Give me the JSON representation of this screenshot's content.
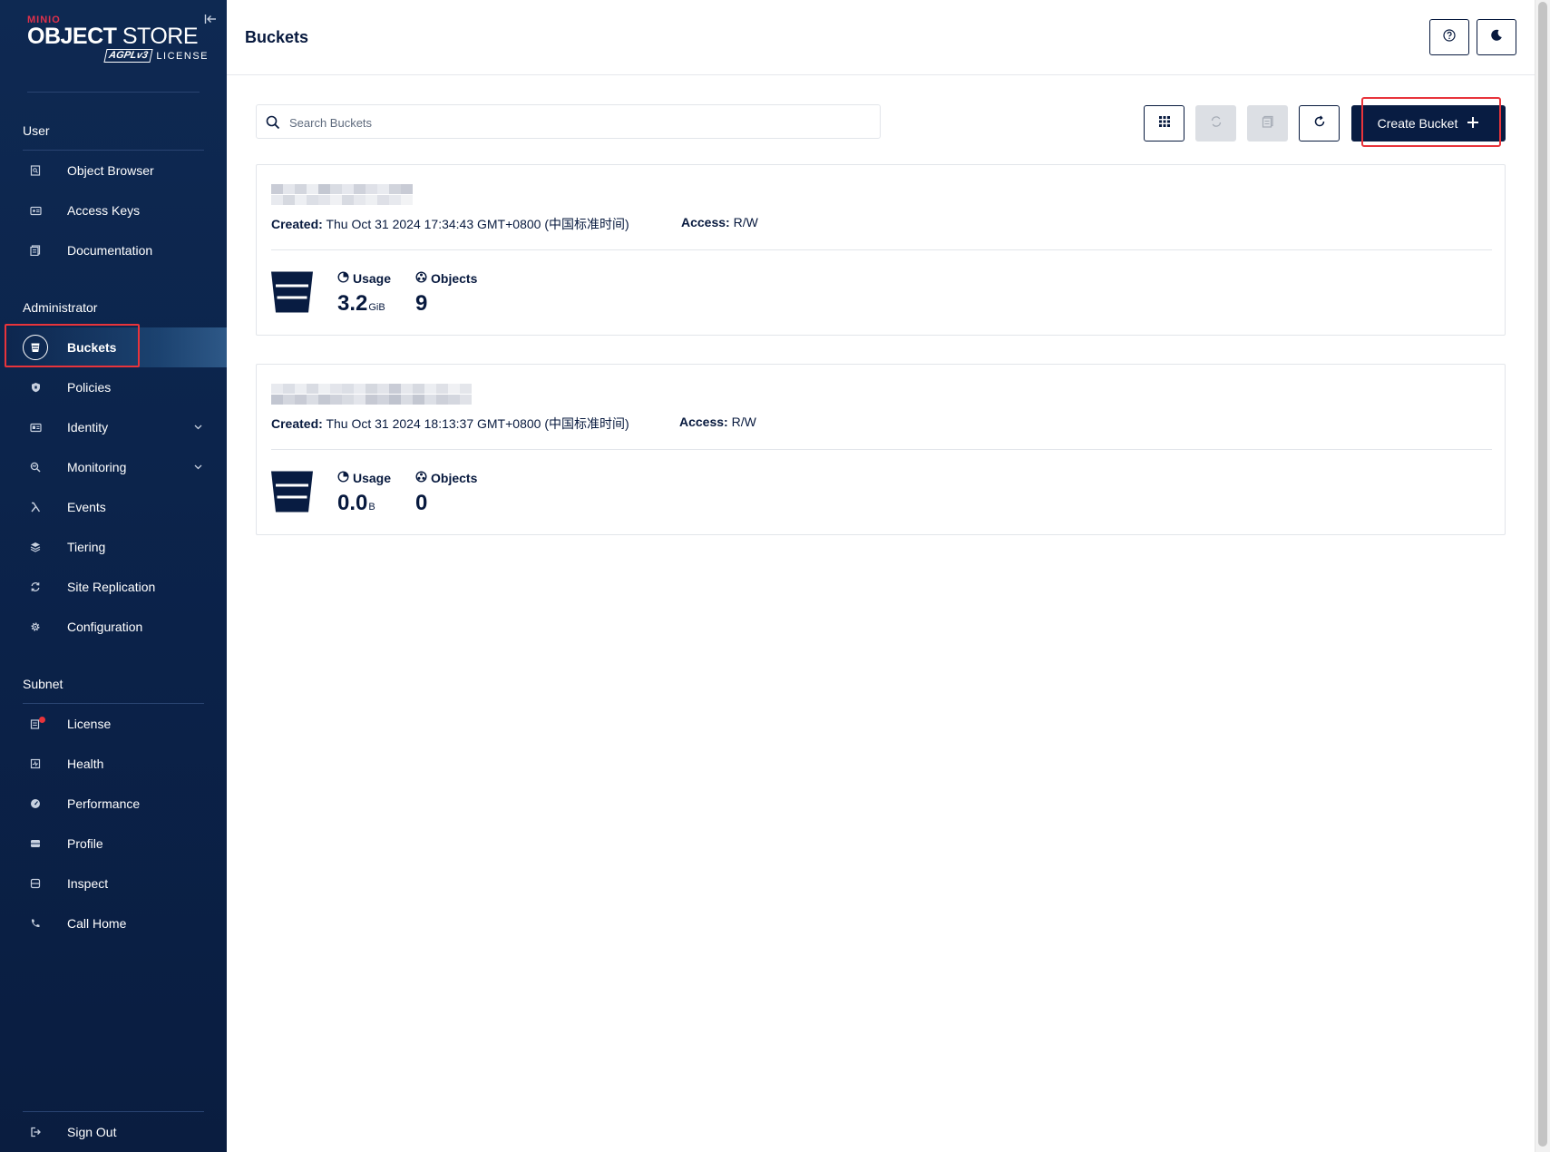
{
  "logo": {
    "brand": "MINIO",
    "product_bold": "OBJECT",
    "product_rest": " STORE",
    "agpl": "AGPLv3",
    "license_word": "LICENSE"
  },
  "sidebar": {
    "sections": {
      "user": "User",
      "administrator": "Administrator",
      "subnet": "Subnet"
    },
    "user_items": [
      "Object Browser",
      "Access Keys",
      "Documentation"
    ],
    "admin_items": [
      "Buckets",
      "Policies",
      "Identity",
      "Monitoring",
      "Events",
      "Tiering",
      "Site Replication",
      "Configuration"
    ],
    "subnet_items": [
      "License",
      "Health",
      "Performance",
      "Profile",
      "Inspect",
      "Call Home"
    ],
    "sign_out": "Sign Out",
    "active_item": "Buckets"
  },
  "header": {
    "title": "Buckets"
  },
  "search": {
    "placeholder": "Search Buckets",
    "value": ""
  },
  "toolbar": {
    "create_label": "Create Bucket"
  },
  "buckets": [
    {
      "created_label": "Created:",
      "created": "Thu Oct 31 2024 17:34:43 GMT+0800 (中国标准时间)",
      "access_label": "Access:",
      "access": "R/W",
      "usage_label": "Usage",
      "usage_value": "3.2",
      "usage_unit": "GiB",
      "objects_label": "Objects",
      "objects_value": "9"
    },
    {
      "created_label": "Created:",
      "created": "Thu Oct 31 2024 18:13:37 GMT+0800 (中国标准时间)",
      "access_label": "Access:",
      "access": "R/W",
      "usage_label": "Usage",
      "usage_value": "0.0",
      "usage_unit": "B",
      "objects_label": "Objects",
      "objects_value": "0"
    }
  ],
  "colors": {
    "navy": "#081c42",
    "highlight": "#e8343b",
    "sidebar": "#0e2952"
  }
}
